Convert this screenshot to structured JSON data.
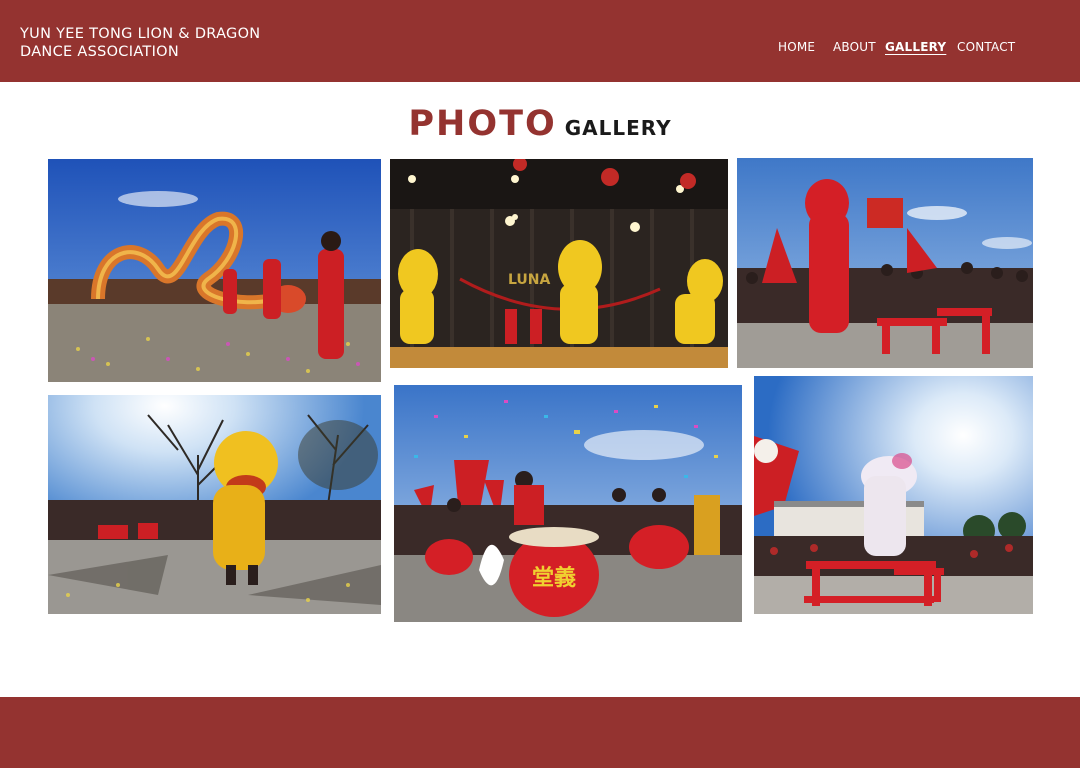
{
  "site": {
    "brand_line1": "YUN YEE TONG LION & DRAGON",
    "brand_line2": "DANCE ASSOCIATION"
  },
  "nav": {
    "items": [
      {
        "label": "HOME",
        "active": false
      },
      {
        "label": "ABOUT",
        "active": false
      },
      {
        "label": "GALLERY",
        "active": true
      },
      {
        "label": "CONTACT",
        "active": false
      }
    ]
  },
  "page": {
    "title_word1": "PHOTO",
    "title_word2": "GALLERY"
  },
  "gallery": {
    "photos": [
      {
        "name": "dragon-dance-parade-photo"
      },
      {
        "name": "lunar-new-year-stage-lions-photo"
      },
      {
        "name": "red-lion-on-benches-photo"
      },
      {
        "name": "yellow-lion-street-photo"
      },
      {
        "name": "drummers-confetti-photo"
      },
      {
        "name": "white-lion-on-benches-photo"
      }
    ]
  },
  "colors": {
    "brand": "#943330",
    "text_dark": "#1a1a1a",
    "white": "#ffffff"
  }
}
